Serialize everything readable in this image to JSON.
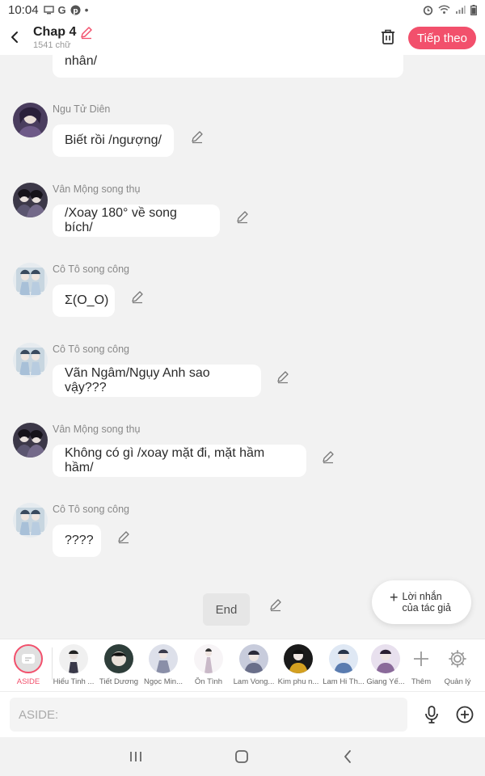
{
  "status_bar": {
    "time": "10:04",
    "left_icons": [
      "screen-icon",
      "google-icon",
      "pinterest-icon",
      "dot-icon"
    ],
    "right_icons": [
      "alarm-icon",
      "wifi-icon",
      "signal-icon",
      "battery-icon"
    ]
  },
  "header": {
    "title": "Chap 4",
    "subtitle": "1541 chữ",
    "next_label": "Tiếp theo"
  },
  "messages": [
    {
      "name": "",
      "text": "nhân/",
      "avatar": "none"
    },
    {
      "name": "Ngu Tử Diên",
      "text": "Biết rồi /ngượng/",
      "avatar": "purple-haired"
    },
    {
      "name": "Vân Mộng song thụ",
      "text": "/Xoay 180° về song bích/",
      "avatar": "duo-dark"
    },
    {
      "name": "Cô Tô song công",
      "text": "Σ(O_O)",
      "avatar": "duo-light"
    },
    {
      "name": "Cô Tô song công",
      "text": "Vãn Ngâm/Ngụy Anh sao vậy???",
      "avatar": "duo-light"
    },
    {
      "name": "Vân Mộng song thụ",
      "text": "Không có gì /xoay mặt đi, mặt hầm hầm/",
      "avatar": "duo-dark"
    },
    {
      "name": "Cô Tô song công",
      "text": "????",
      "avatar": "duo-light"
    }
  ],
  "end_label": "End",
  "author_note": {
    "line1": "Lời nhắn",
    "line2": "của tác giả"
  },
  "characters": [
    {
      "label": "ASIDE",
      "color": "#e0e0e0"
    },
    {
      "label": "Hiểu Tinh ...",
      "color": "#3a3a4a"
    },
    {
      "label": "Tiết Dương",
      "color": "#2e3e3a"
    },
    {
      "label": "Ngọc Min...",
      "color": "#8a8fa8"
    },
    {
      "label": "Ôn Tình",
      "color": "#c9b9c8"
    },
    {
      "label": "Lam Vong...",
      "color": "#6a6f8a"
    },
    {
      "label": "Kim phu n...",
      "color": "#d4a020"
    },
    {
      "label": "Lam Hi Th...",
      "color": "#5a7cb0"
    },
    {
      "label": "Giang Yế...",
      "color": "#8a6a9a"
    }
  ],
  "more_label": "Thêm",
  "manage_label": "Quản lý",
  "input": {
    "placeholder": "ASIDE:"
  },
  "colors": {
    "accent": "#f2506c",
    "bubble": "#ffffff",
    "background": "#f2f2f2"
  }
}
